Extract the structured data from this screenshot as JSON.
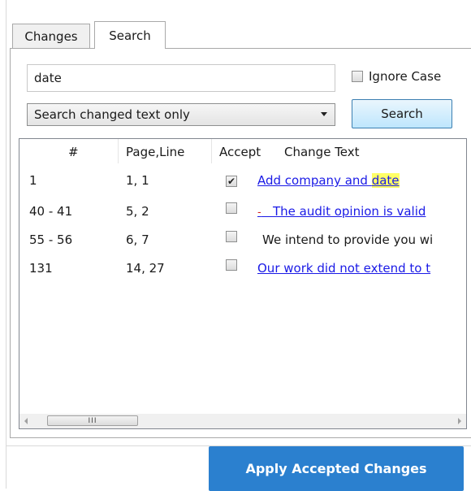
{
  "tabs": [
    {
      "label": "Changes",
      "active": false
    },
    {
      "label": "Search",
      "active": true
    }
  ],
  "search": {
    "query": "date",
    "ignore_case_label": "Ignore Case",
    "ignore_case_checked": false,
    "scope_selected": "Search changed text only",
    "search_button_label": "Search"
  },
  "results": {
    "columns": [
      "#",
      "Page,Line",
      "Accept",
      "Change Text"
    ],
    "rows": [
      {
        "num": "1",
        "page_line": "1, 1",
        "accepted": true,
        "text_before": "Add company and ",
        "text_match": "date",
        "text_after": "",
        "is_link": true
      },
      {
        "num": "40 - 41",
        "page_line": "5, 2",
        "accepted": false,
        "text": "The audit opinion is valid",
        "is_link": true
      },
      {
        "num": "55 - 56",
        "page_line": "6, 7",
        "accepted": false,
        "text": "We intend to provide you wi",
        "is_link": false
      },
      {
        "num": "131",
        "page_line": "14, 27",
        "accepted": false,
        "text": "Our work did not extend to t",
        "is_link": true
      }
    ]
  },
  "scrollbar_thumb_glyph": "III",
  "apply_button_label": "Apply Accepted Changes",
  "colors": {
    "link": "#1a1ae6",
    "highlight": "#ffff66",
    "apply_button": "#2b80cf"
  }
}
